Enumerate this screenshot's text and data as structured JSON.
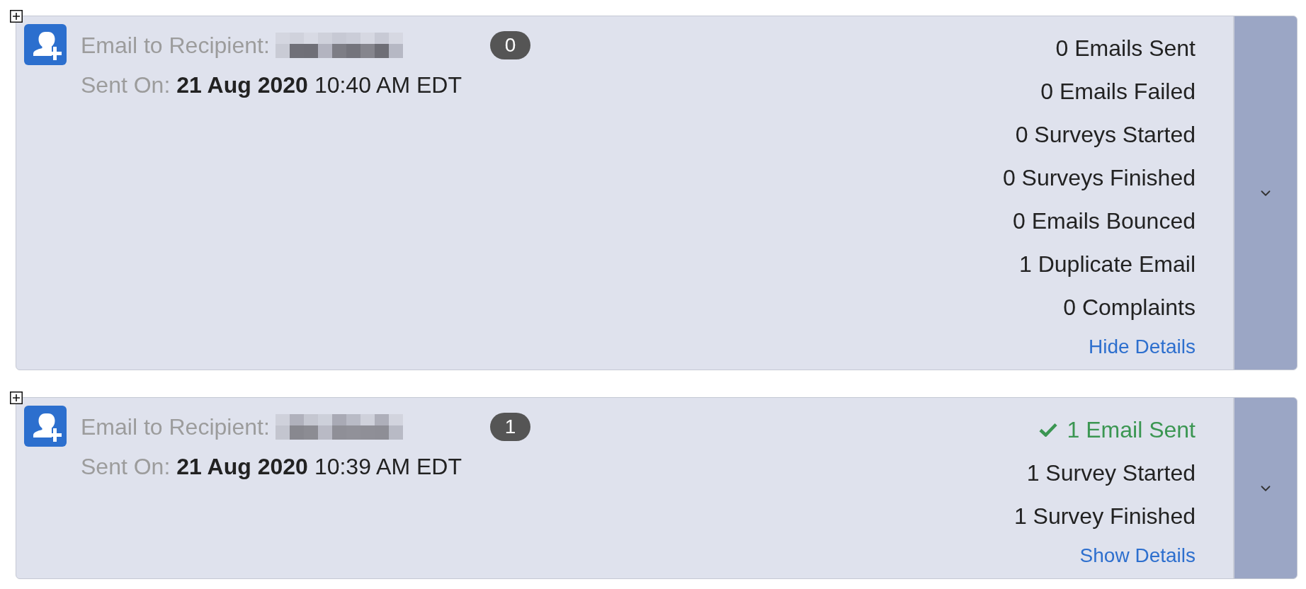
{
  "deliveries": [
    {
      "recipient_label": "Email to Recipient:",
      "badge": "0",
      "sent_label": "Sent On:",
      "sent_date": "21 Aug 2020",
      "sent_time": "10:40 AM EDT",
      "stats": [
        {
          "kind": "count",
          "text": "0 Emails Sent"
        },
        {
          "kind": "count",
          "text": "0 Emails Failed"
        },
        {
          "kind": "count",
          "text": "0 Surveys Started"
        },
        {
          "kind": "count",
          "text": "0 Surveys Finished"
        },
        {
          "kind": "count",
          "text": "0 Emails Bounced"
        },
        {
          "kind": "count",
          "text": "1 Duplicate Email"
        },
        {
          "kind": "count",
          "text": "0 Complaints"
        }
      ],
      "details_link": "Hide Details"
    },
    {
      "recipient_label": "Email to Recipient:",
      "badge": "1",
      "sent_label": "Sent On:",
      "sent_date": "21 Aug 2020",
      "sent_time": "10:39 AM EDT",
      "stats": [
        {
          "kind": "success",
          "text": "1 Email Sent"
        },
        {
          "kind": "count",
          "text": "1 Survey Started"
        },
        {
          "kind": "count",
          "text": "1 Survey Finished"
        }
      ],
      "details_link": "Show Details"
    }
  ]
}
